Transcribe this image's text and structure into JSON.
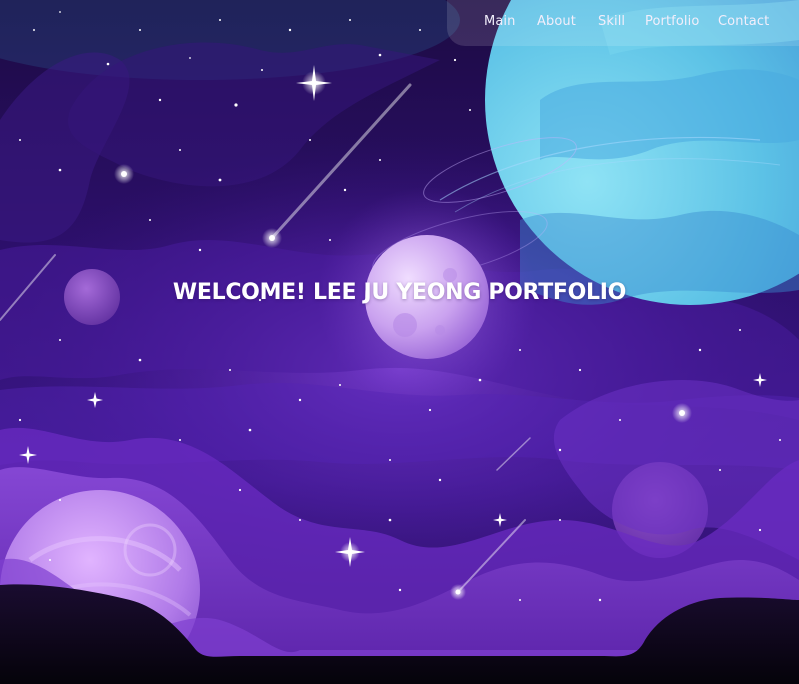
{
  "nav": {
    "items": [
      {
        "id": "main",
        "label": "Main"
      },
      {
        "id": "about",
        "label": "About"
      },
      {
        "id": "skill",
        "label": "Skill"
      },
      {
        "id": "portfolio",
        "label": "Portfolio"
      },
      {
        "id": "contact",
        "label": "Contact"
      }
    ]
  },
  "hero": {
    "headline": "WELCOME! LEE JU YEONG PORTFOLIO"
  },
  "colors": {
    "sky_top": "#1e0a4a",
    "sky_mid": "#3a1486",
    "nebula": "#6a2ec8",
    "planet_blue": "#5ac8e8",
    "planet_violet": "#b47be8",
    "nav_text": "#f2eefb",
    "headline": "#ffffff"
  }
}
